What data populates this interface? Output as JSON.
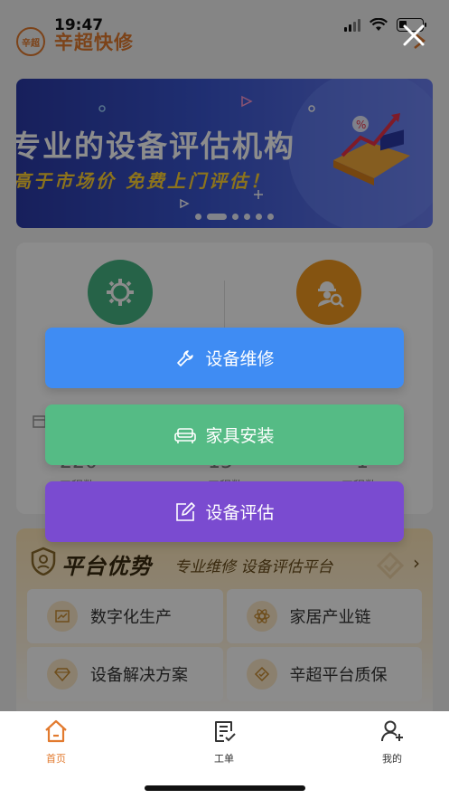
{
  "status_bar": {
    "time": "19:47"
  },
  "header": {
    "logo_text": "辛超",
    "title": "辛超快修"
  },
  "banner": {
    "title": "专业的设备评估机构",
    "subtitle": "高于市场价 免费上门评估！"
  },
  "service_card": {
    "stats": [
      {
        "value": "220",
        "label": "工程数"
      },
      {
        "value": "15",
        "label": "工程数"
      },
      {
        "value": "1",
        "label": "工程数"
      }
    ]
  },
  "advantage": {
    "title": "平台优势",
    "subtitle": "专业维修 设备评估平台",
    "items": [
      {
        "label": "数字化生产",
        "icon": "chart-icon"
      },
      {
        "label": "家居产业链",
        "icon": "atom-icon"
      },
      {
        "label": "设备解决方案",
        "icon": "diamond-icon"
      },
      {
        "label": "辛超平台质保",
        "icon": "heart-shield-icon"
      }
    ]
  },
  "overlay_menu": {
    "items": [
      {
        "label": "设备维修",
        "icon": "wrench-icon",
        "color": "#3f8cf3"
      },
      {
        "label": "家具安装",
        "icon": "sofa-icon",
        "color": "#55bb85"
      },
      {
        "label": "设备评估",
        "icon": "edit-icon",
        "color": "#7a4bd0"
      }
    ]
  },
  "tabbar": {
    "items": [
      {
        "label": "首页",
        "icon": "home-icon",
        "active": true
      },
      {
        "label": "工单",
        "icon": "document-check-icon",
        "active": false
      },
      {
        "label": "我的",
        "icon": "user-add-icon",
        "active": false
      }
    ]
  },
  "colors": {
    "accent": "#e27a2e",
    "repair": "#3f8cf3",
    "furniture": "#55bb85",
    "evaluation": "#7a4bd0"
  }
}
